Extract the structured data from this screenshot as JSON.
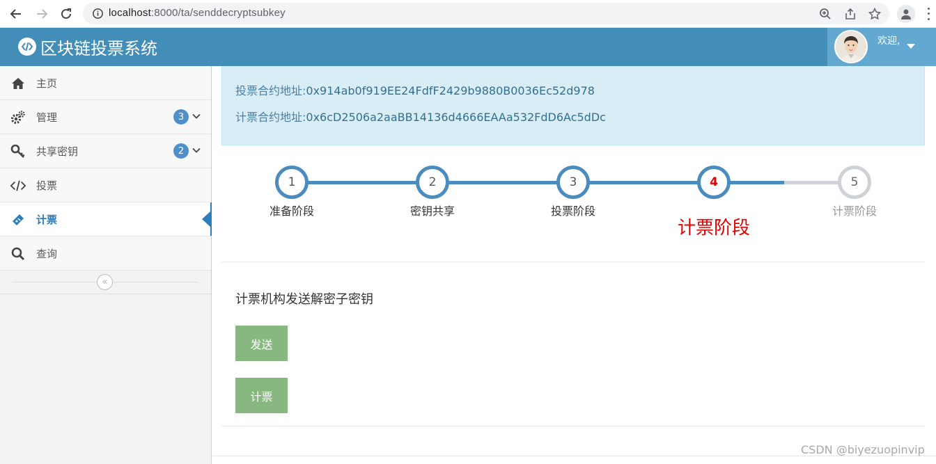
{
  "browser": {
    "url_host": "localhost",
    "url_path": ":8000/ta/senddecryptsubkey"
  },
  "header": {
    "app_title": "区块链投票系统",
    "welcome": "欢迎,",
    "brand_color": "#438eb9",
    "user_box_color": "#62a8d1"
  },
  "sidebar": {
    "items": [
      {
        "label": "主页",
        "icon": "home-icon"
      },
      {
        "label": "管理",
        "icon": "cogs-icon",
        "badge": "3"
      },
      {
        "label": "共享密钥",
        "icon": "key-icon",
        "badge": "2"
      },
      {
        "label": "投票",
        "icon": "code-icon"
      },
      {
        "label": "计票",
        "icon": "ticket-icon",
        "active": true
      },
      {
        "label": "查询",
        "icon": "search-icon"
      }
    ],
    "collapse_symbol": "«"
  },
  "contracts": {
    "vote_label": "投票合约地址:",
    "vote_address": "0x914ab0f919EE24FdfF2429b9880B0036Ec52d978",
    "count_label": "计票合约地址:",
    "count_address": "0x6cD2506a2aaBB14136d4666EAAa532FdD6Ac5dDc"
  },
  "steps": {
    "items": [
      {
        "number": "1",
        "label": "准备阶段",
        "state": "done"
      },
      {
        "number": "2",
        "label": "密钥共享",
        "state": "done"
      },
      {
        "number": "3",
        "label": "投票阶段",
        "state": "done"
      },
      {
        "number": "4",
        "label": "",
        "state": "current"
      },
      {
        "number": "5",
        "label": "计票阶段",
        "state": "todo"
      }
    ],
    "current_title": "计票阶段",
    "active_color": "#4b8cc0",
    "inactive_color": "#ced1d6"
  },
  "main": {
    "heading": "计票机构发送解密子密钥",
    "send_button": "发送",
    "count_button": "计票",
    "button_color": "#87b87f"
  },
  "watermark": "CSDN @biyezuopinvip"
}
